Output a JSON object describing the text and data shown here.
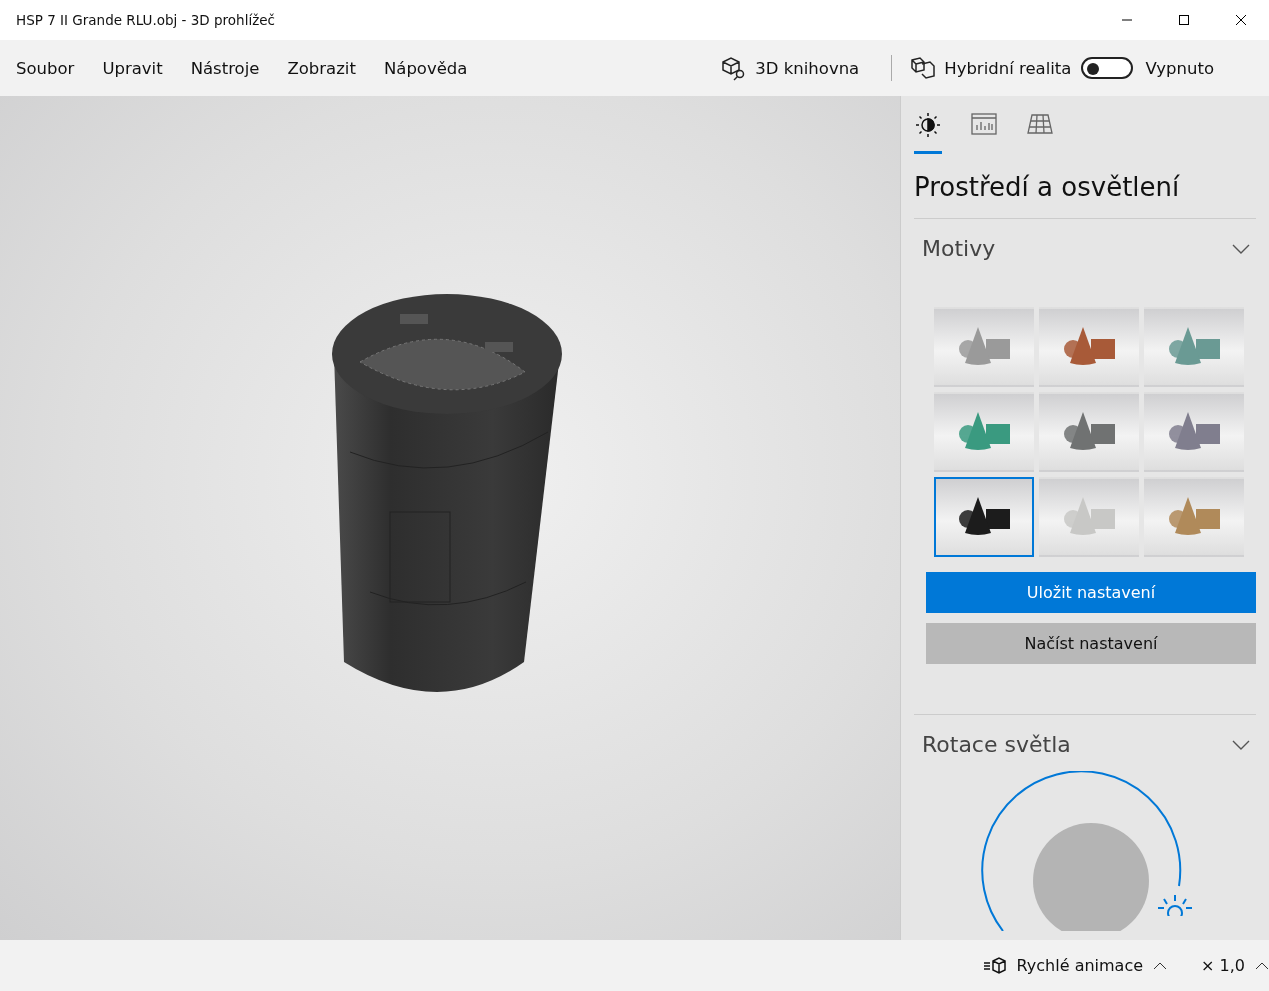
{
  "window": {
    "title": "HSP 7 II Grande RLU.obj - 3D prohlížeč"
  },
  "menu": [
    "Soubor",
    "Upravit",
    "Nástroje",
    "Zobrazit",
    "Nápověda"
  ],
  "library_button": "3D knihovna",
  "mixed_reality": {
    "label": "Hybridní realita",
    "on": false,
    "state_label": "Vypnuto"
  },
  "panel_tabs": [
    {
      "kind": "lighting",
      "selected": true
    },
    {
      "kind": "stats",
      "selected": false
    },
    {
      "kind": "grid",
      "selected": false
    }
  ],
  "panel_title": "Prostředí a osvětlení",
  "themes_section": {
    "title": "Motivy",
    "themes": [
      {
        "color": "#9a9a9a",
        "selected": false
      },
      {
        "color": "#a85a38",
        "selected": false
      },
      {
        "color": "#6a9a94",
        "selected": false
      },
      {
        "color": "#3a9a80",
        "selected": false
      },
      {
        "color": "#707272",
        "selected": false
      },
      {
        "color": "#807e8e",
        "selected": false
      },
      {
        "color": "#1c1c1c",
        "selected": true
      },
      {
        "color": "#c8c8c6",
        "selected": false
      },
      {
        "color": "#b08a5a",
        "selected": false
      }
    ],
    "save_button": "Uložit nastavení",
    "load_button": "Načíst nastavení"
  },
  "light_section": {
    "title": "Rotace světla"
  },
  "status_bar": {
    "animation_label": "Rychlé animace",
    "speed": "× 1,0"
  }
}
